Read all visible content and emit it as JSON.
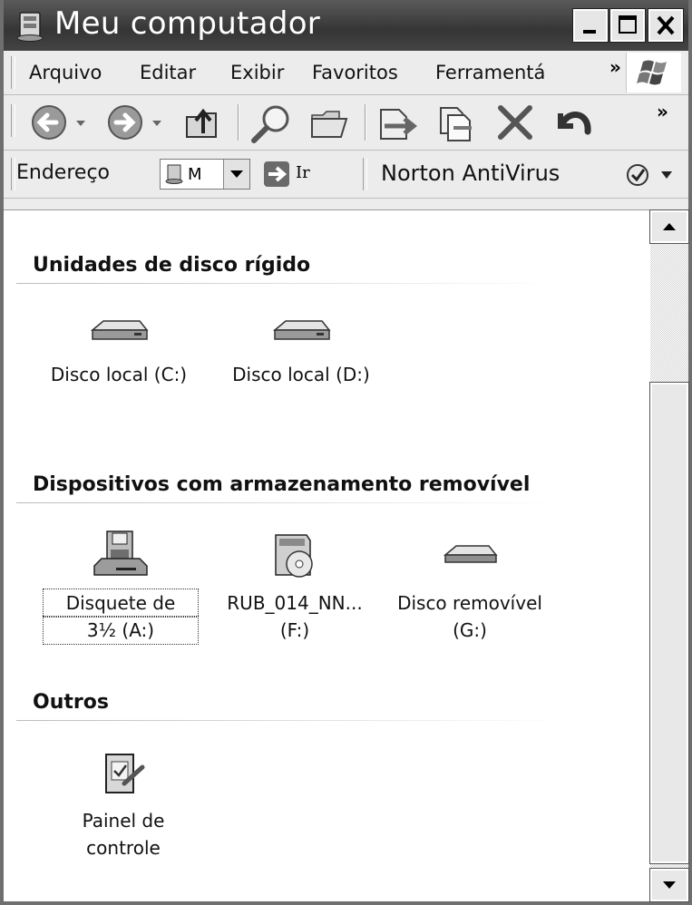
{
  "window": {
    "title": "Meu computador"
  },
  "menubar": {
    "items": [
      "Arquivo",
      "Editar",
      "Exibir",
      "Favoritos",
      "Ferramentá"
    ],
    "more": "»"
  },
  "toolbar": {
    "more": "»"
  },
  "addressbar": {
    "label": "Endereço",
    "value": "M",
    "go_label": "Ir",
    "norton_label": "Norton AntiVirus"
  },
  "sections": {
    "hard_drives": {
      "title": "Unidades de disco rígido",
      "items": [
        {
          "label": "Disco local (C:)"
        },
        {
          "label": "Disco local (D:)"
        }
      ]
    },
    "removable": {
      "title": "Dispositivos com armazenamento removível",
      "items": [
        {
          "line1": "Disquete de",
          "line2": "3½ (A:)"
        },
        {
          "line1": "RUB_014_NN...",
          "line2": "(F:)"
        },
        {
          "line1": "Disco removível",
          "line2": "(G:)"
        }
      ]
    },
    "others": {
      "title": "Outros",
      "items": [
        {
          "line1": "Painel de",
          "line2": "controle"
        }
      ]
    }
  },
  "icons": {
    "title": "my-computer-icon",
    "back": "back-arrow-icon",
    "forward": "forward-arrow-icon",
    "up": "folder-up-icon",
    "search": "search-icon",
    "folders": "folders-icon",
    "move": "move-to-icon",
    "copy": "copy-to-icon",
    "delete": "delete-icon",
    "undo": "undo-icon"
  },
  "colors": {
    "titlebar": "#3e3e3e",
    "chrome": "#ececec"
  }
}
